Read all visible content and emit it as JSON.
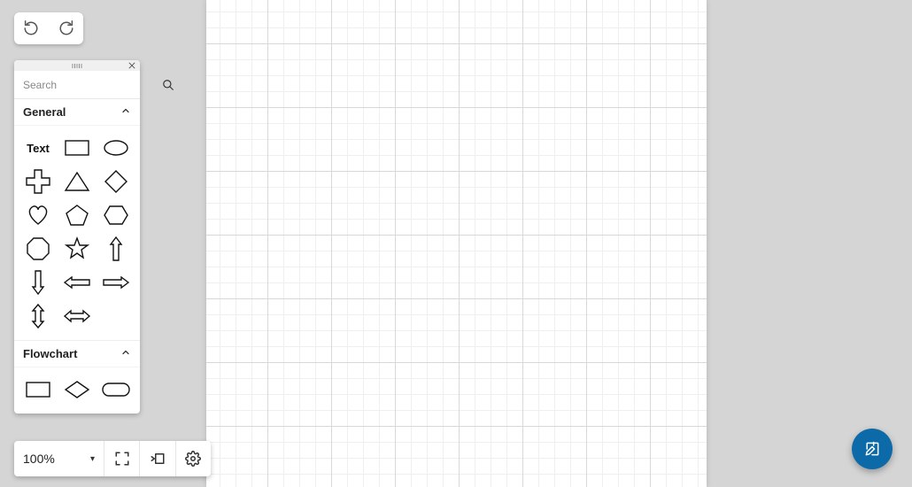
{
  "toolbar": {
    "undo_icon": "undo",
    "redo_icon": "redo"
  },
  "search": {
    "placeholder": "Search"
  },
  "sections": {
    "general": {
      "title": "General"
    },
    "flowchart": {
      "title": "Flowchart"
    }
  },
  "shapes": {
    "text_label": "Text"
  },
  "zoom": {
    "value": "100%"
  },
  "colors": {
    "fab": "#0d6aa8"
  }
}
